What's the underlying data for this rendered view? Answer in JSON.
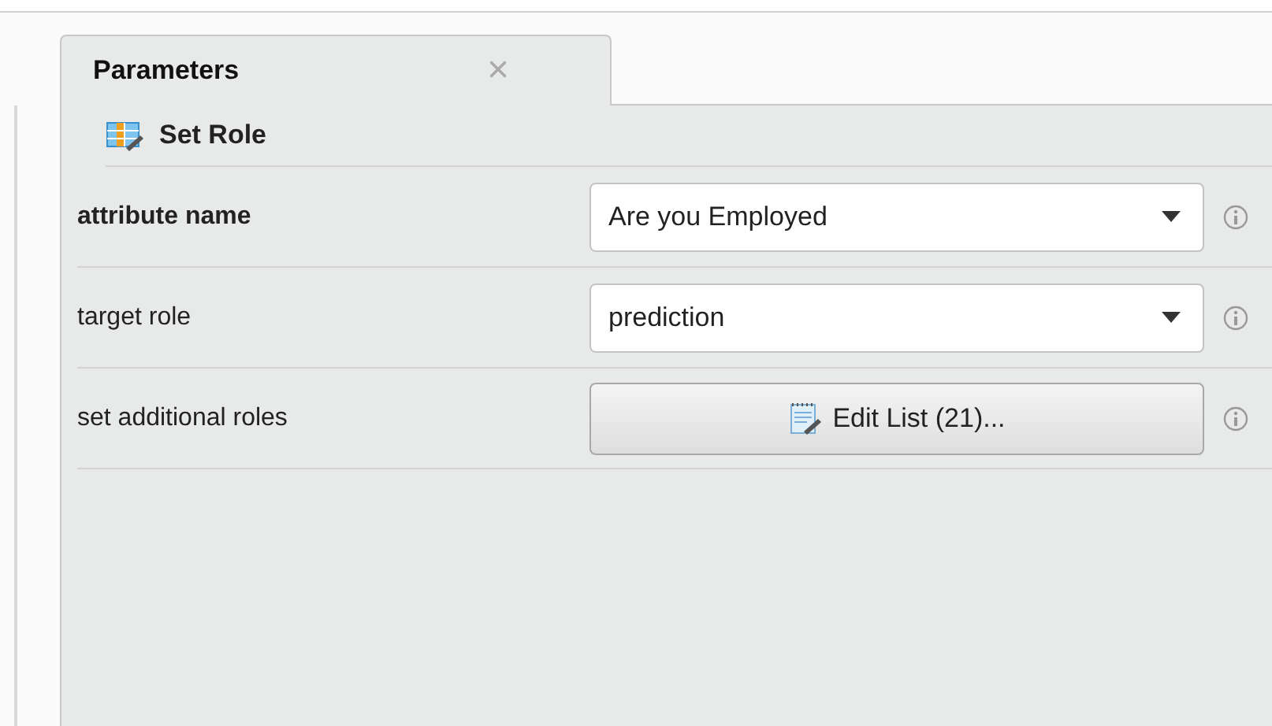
{
  "tab": {
    "label": "Parameters",
    "close": "×"
  },
  "operator": {
    "name": "Set Role"
  },
  "parameters": [
    {
      "label": "attribute name",
      "emphasized": true,
      "kind": "dropdown",
      "value": "Are you Employed"
    },
    {
      "label": "target role",
      "emphasized": false,
      "kind": "dropdown",
      "value": "prediction"
    },
    {
      "label": "set additional roles",
      "emphasized": false,
      "kind": "button",
      "value": "Edit List (21)..."
    }
  ]
}
